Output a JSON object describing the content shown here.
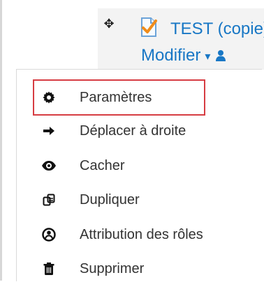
{
  "activity": {
    "title": "TEST (copie)",
    "edit_label": "Modifier",
    "move_icon": "move-handle-icon",
    "activity_icon": "assignment-icon",
    "caret_icon": "chevron-down-icon",
    "role_icon": "user-icon",
    "colors": {
      "link": "#1877c5",
      "highlight": "#d63c42",
      "bar": "#f3f3f3"
    }
  },
  "menu": {
    "items": [
      {
        "label": "Paramètres",
        "icon": "gear-icon"
      },
      {
        "label": "Déplacer à droite",
        "icon": "arrow-right-icon"
      },
      {
        "label": "Cacher",
        "icon": "eye-icon"
      },
      {
        "label": "Dupliquer",
        "icon": "duplicate-icon"
      },
      {
        "label": "Attribution des rôles",
        "icon": "user-circle-icon"
      },
      {
        "label": "Supprimer",
        "icon": "trash-icon"
      }
    ]
  }
}
